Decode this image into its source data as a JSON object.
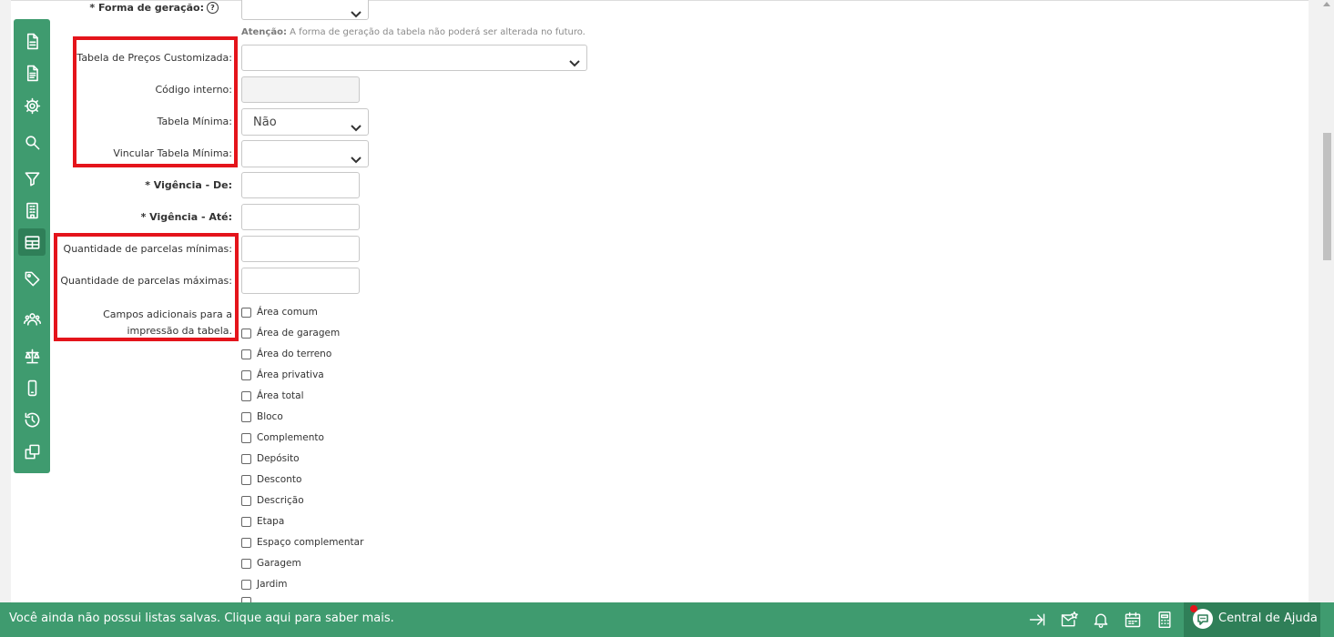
{
  "form": {
    "forma_geracao": {
      "label": "* Forma de geração:",
      "help": "?"
    },
    "atencao": {
      "prefix": "Atenção:",
      "text": " A forma de geração da tabela não poderá ser alterada no futuro."
    },
    "tabela_customizada": {
      "label": "Tabela de Preços Customizada:",
      "value": ""
    },
    "codigo_interno": {
      "label": "Código interno:",
      "value": ""
    },
    "tabela_minima": {
      "label": "Tabela Mínima:",
      "value": "Não"
    },
    "vincular_tabela_minima": {
      "label": "Vincular Tabela Mínima:",
      "value": ""
    },
    "vigencia_de": {
      "label": "* Vigência - De:"
    },
    "vigencia_ate": {
      "label": "* Vigência - Até:"
    },
    "parcelas_minimas": {
      "label": "Quantidade de parcelas mínimas:"
    },
    "parcelas_maximas": {
      "label": "Quantidade de parcelas máximas:"
    },
    "campos_adicionais": {
      "label_line1": "Campos adicionais para a",
      "label_line2": "impressão da tabela."
    },
    "checkboxes": [
      "Área comum",
      "Área de garagem",
      "Área do terreno",
      "Área privativa",
      "Área total",
      "Bloco",
      "Complemento",
      "Depósito",
      "Desconto",
      "Descrição",
      "Etapa",
      "Espaço complementar",
      "Garagem",
      "Jardim"
    ]
  },
  "sidebar": {
    "items": [
      "document-icon",
      "document-text-icon",
      "gear-icon",
      "search-icon",
      "filter-icon",
      "building-icon",
      "table-icon",
      "tag-icon",
      "people-icon",
      "scale-icon",
      "mobile-icon",
      "history-icon",
      "copy-icon"
    ],
    "active_index": 6
  },
  "footer": {
    "message": "Você ainda não possui listas salvas. Clique aqui para saber mais.",
    "help_label": "Central de Ajuda"
  },
  "colors": {
    "brand_green": "#3f9b6f",
    "brand_green_dark": "#2f7f58",
    "highlight_red": "#e4141b"
  }
}
